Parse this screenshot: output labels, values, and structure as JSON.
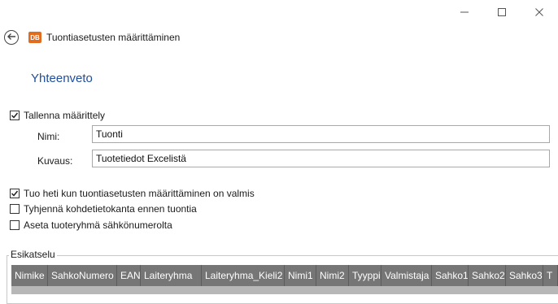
{
  "window": {
    "minimize_icon": "minimize-icon",
    "maximize_icon": "maximize-icon",
    "close_icon": "close-icon"
  },
  "header": {
    "app_icon_text": "DB",
    "title": "Tuontiasetusten määrittäminen"
  },
  "section_title": "Yhteenveto",
  "save_definition": {
    "label": "Tallenna määrittely",
    "checked": true
  },
  "name_field": {
    "label": "Nimi:",
    "value": "Tuonti"
  },
  "description_field": {
    "label": "Kuvaus:",
    "value": "Tuotetiedot Excelistä"
  },
  "options": [
    {
      "label": "Tuo heti kun tuontiasetusten määrittäminen on valmis",
      "checked": true
    },
    {
      "label": "Tyhjennä kohdetietokanta ennen tuontia",
      "checked": false
    },
    {
      "label": "Aseta tuoteryhmä sähkönumerolta",
      "checked": false
    }
  ],
  "preview": {
    "label": "Esikatselu",
    "columns": [
      "Nimike",
      "SahkoNumero",
      "EAN",
      "Laiteryhma",
      "Laiteryhma_Kieli2",
      "Nimi1",
      "Nimi2",
      "Tyyppi",
      "Valmistaja",
      "Sahko1",
      "Sahko2",
      "Sahko3",
      "T"
    ]
  },
  "colors": {
    "accent": "#1f4e9b",
    "grid_header_bg": "#767676",
    "app_icon_bg": "#e06c1f"
  }
}
